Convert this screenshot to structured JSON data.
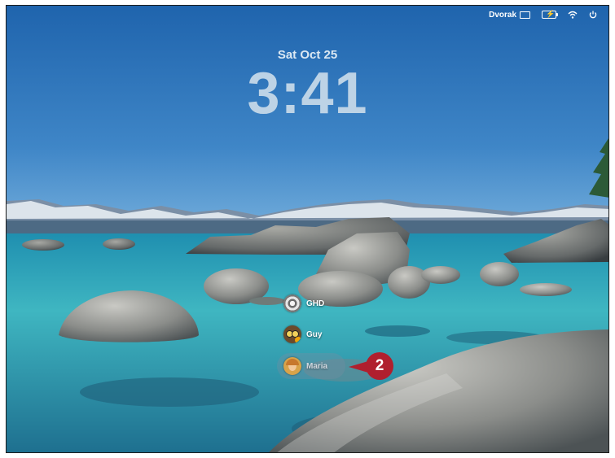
{
  "menubar": {
    "keyboard_layout": "Dvorak",
    "battery_icon": "battery-charging-icon",
    "wifi_icon": "wifi-icon",
    "power_icon": "power-icon"
  },
  "lockscreen": {
    "date": "Sat Oct 25",
    "time": "3:41"
  },
  "users": [
    {
      "name": "GHD",
      "avatar_icon": "swirl-avatar-icon"
    },
    {
      "name": "Guy",
      "avatar_icon": "owl-avatar-icon"
    },
    {
      "name": "Maria",
      "avatar_icon": "portrait-avatar-icon"
    }
  ],
  "annotation": {
    "callout_number": "2",
    "color": "#b01f2e"
  }
}
